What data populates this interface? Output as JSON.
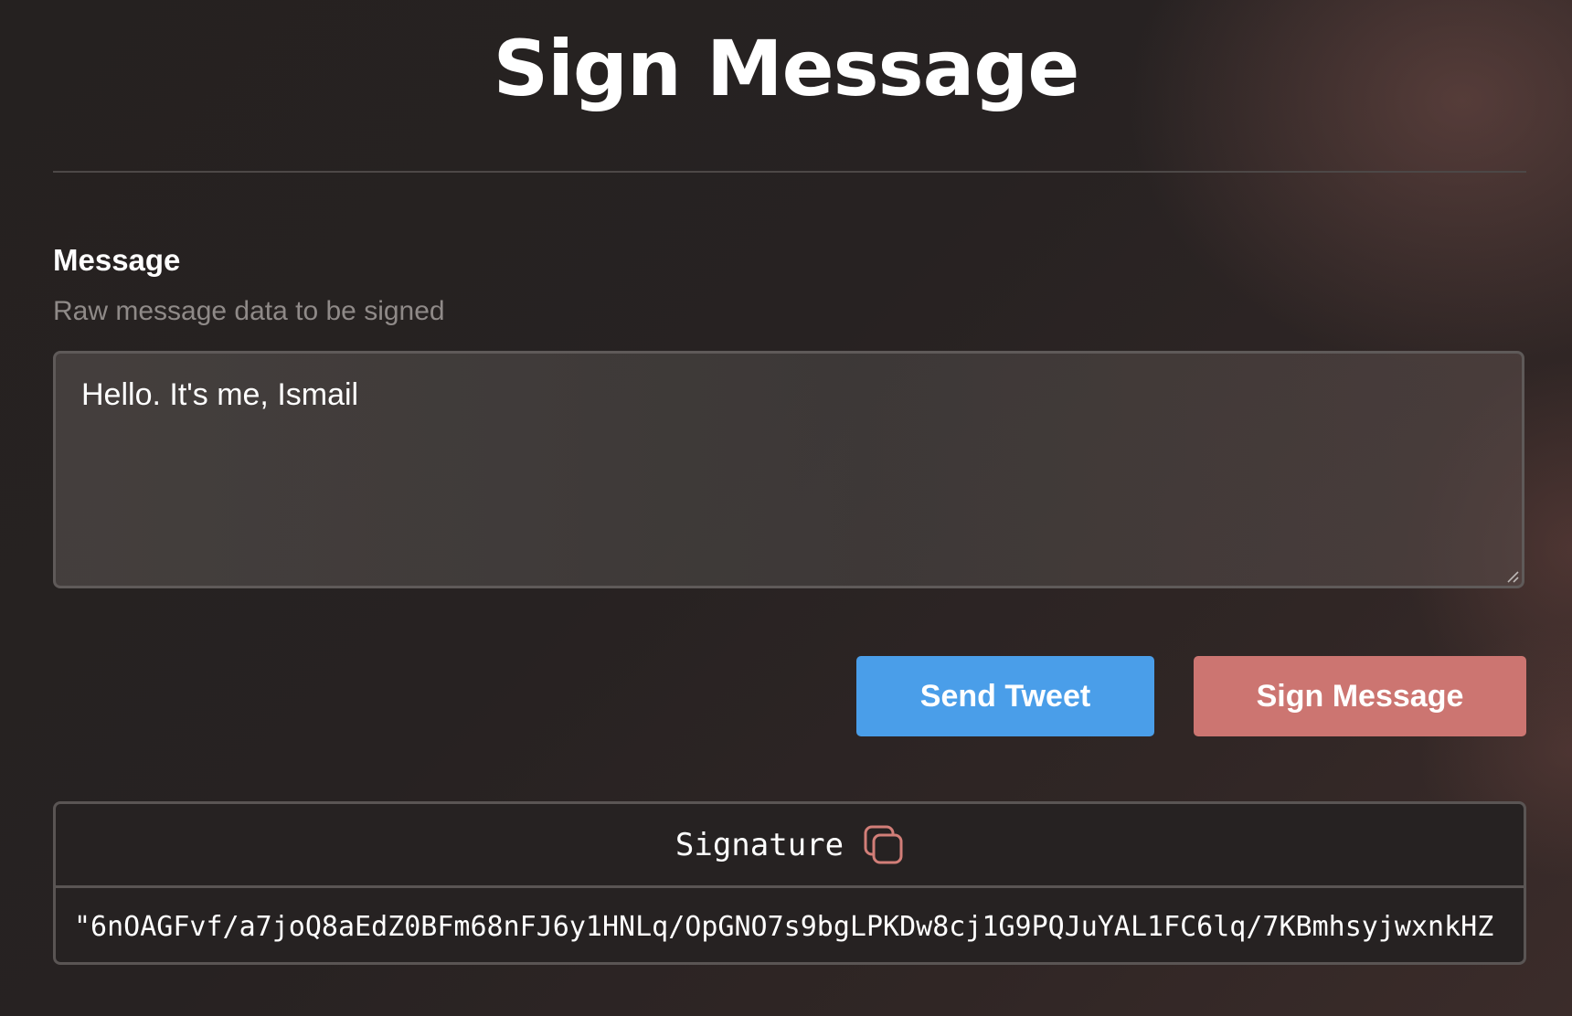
{
  "page": {
    "title": "Sign Message"
  },
  "message_field": {
    "label": "Message",
    "help_text": "Raw message data to be signed",
    "value": "Hello. It's me, Ismail"
  },
  "actions": {
    "send_tweet_label": "Send Tweet",
    "sign_message_label": "Sign Message"
  },
  "signature": {
    "label": "Signature",
    "value": "\"6nOAGFvf/a7joQ8aEdZ0BFm68nFJ6y1HNLq/OpGNO7s9bgLPKDw8cj1G9PQJuYAL1FC6lq/7KBmhsyjwxnkHZ",
    "copy_icon": "copy-icon"
  },
  "colors": {
    "send_tweet": "#4a9ee9",
    "sign_message": "#cc7571",
    "copy_icon": "#d27e78"
  }
}
